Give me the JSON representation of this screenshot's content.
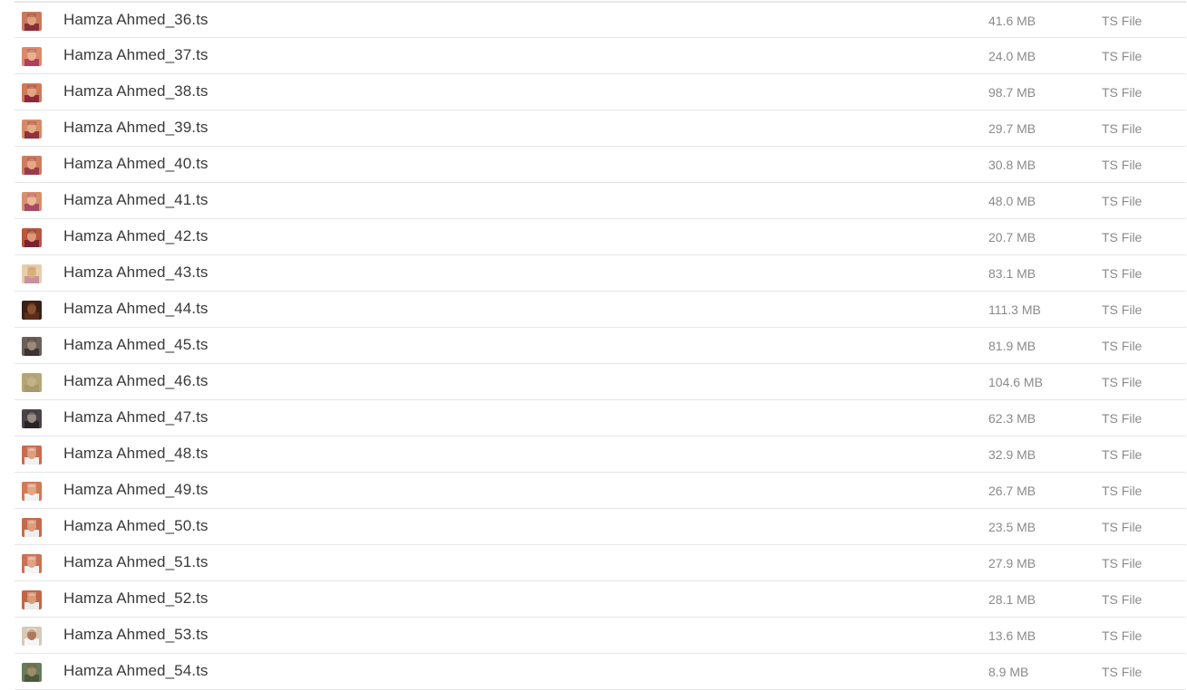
{
  "files": [
    {
      "name": "Hamza Ahmed_36.ts",
      "size": "41.6 MB",
      "kind": "TS File",
      "thumb": {
        "bg": "#c97a5a",
        "fg": "#8a2d3a",
        "face": "#e0a07c"
      }
    },
    {
      "name": "Hamza Ahmed_37.ts",
      "size": "24.0 MB",
      "kind": "TS File",
      "thumb": {
        "bg": "#d98a6a",
        "fg": "#b0405a",
        "face": "#e8b090"
      }
    },
    {
      "name": "Hamza Ahmed_38.ts",
      "size": "98.7 MB",
      "kind": "TS File",
      "thumb": {
        "bg": "#cf7b58",
        "fg": "#8c2a3c",
        "face": "#e3a580"
      }
    },
    {
      "name": "Hamza Ahmed_39.ts",
      "size": "29.7 MB",
      "kind": "TS File",
      "thumb": {
        "bg": "#d58c66",
        "fg": "#933040",
        "face": "#e6aa84"
      }
    },
    {
      "name": "Hamza Ahmed_40.ts",
      "size": "30.8 MB",
      "kind": "TS File",
      "thumb": {
        "bg": "#cc7e5e",
        "fg": "#9a3a4a",
        "face": "#e4a883"
      }
    },
    {
      "name": "Hamza Ahmed_41.ts",
      "size": "48.0 MB",
      "kind": "TS File",
      "thumb": {
        "bg": "#d6906e",
        "fg": "#a84a64",
        "face": "#ebb896"
      }
    },
    {
      "name": "Hamza Ahmed_42.ts",
      "size": "20.7 MB",
      "kind": "TS File",
      "thumb": {
        "bg": "#b8563e",
        "fg": "#7a2430",
        "face": "#dc9a76"
      }
    },
    {
      "name": "Hamza Ahmed_43.ts",
      "size": "83.1 MB",
      "kind": "TS File",
      "thumb": {
        "bg": "#e6cfa8",
        "fg": "#c890a0",
        "face": "#d9b07a"
      }
    },
    {
      "name": "Hamza Ahmed_44.ts",
      "size": "111.3 MB",
      "kind": "TS File",
      "thumb": {
        "bg": "#3a2016",
        "fg": "#5a2e1c",
        "face": "#8a5030"
      }
    },
    {
      "name": "Hamza Ahmed_45.ts",
      "size": "81.9 MB",
      "kind": "TS File",
      "thumb": {
        "bg": "#6a6058",
        "fg": "#3c3430",
        "face": "#9a8a78"
      }
    },
    {
      "name": "Hamza Ahmed_46.ts",
      "size": "104.6 MB",
      "kind": "TS File",
      "thumb": {
        "bg": "#b4a676",
        "fg": "#a89a6a",
        "face": "#c2b486"
      }
    },
    {
      "name": "Hamza Ahmed_47.ts",
      "size": "62.3 MB",
      "kind": "TS File",
      "thumb": {
        "bg": "#4a4448",
        "fg": "#2a2428",
        "face": "#9a8a86"
      }
    },
    {
      "name": "Hamza Ahmed_48.ts",
      "size": "32.9 MB",
      "kind": "TS File",
      "thumb": {
        "bg": "#c86c50",
        "fg": "#f0f0f0",
        "face": "#dca080"
      }
    },
    {
      "name": "Hamza Ahmed_49.ts",
      "size": "26.7 MB",
      "kind": "TS File",
      "thumb": {
        "bg": "#d07a58",
        "fg": "#f2f2f2",
        "face": "#e2a684"
      }
    },
    {
      "name": "Hamza Ahmed_50.ts",
      "size": "23.5 MB",
      "kind": "TS File",
      "thumb": {
        "bg": "#c46a4c",
        "fg": "#eeeeee",
        "face": "#dc9e7c"
      }
    },
    {
      "name": "Hamza Ahmed_51.ts",
      "size": "27.9 MB",
      "kind": "TS File",
      "thumb": {
        "bg": "#ca7254",
        "fg": "#f4f4f4",
        "face": "#e0a282"
      }
    },
    {
      "name": "Hamza Ahmed_52.ts",
      "size": "28.1 MB",
      "kind": "TS File",
      "thumb": {
        "bg": "#c26648",
        "fg": "#ececec",
        "face": "#da9a78"
      }
    },
    {
      "name": "Hamza Ahmed_53.ts",
      "size": "13.6 MB",
      "kind": "TS File",
      "thumb": {
        "bg": "#d8c8b8",
        "fg": "#f6f6f6",
        "face": "#b07a58"
      }
    },
    {
      "name": "Hamza Ahmed_54.ts",
      "size": "8.9 MB",
      "kind": "TS File",
      "thumb": {
        "bg": "#6a7a5a",
        "fg": "#4a5a3a",
        "face": "#a08a6a"
      }
    }
  ]
}
